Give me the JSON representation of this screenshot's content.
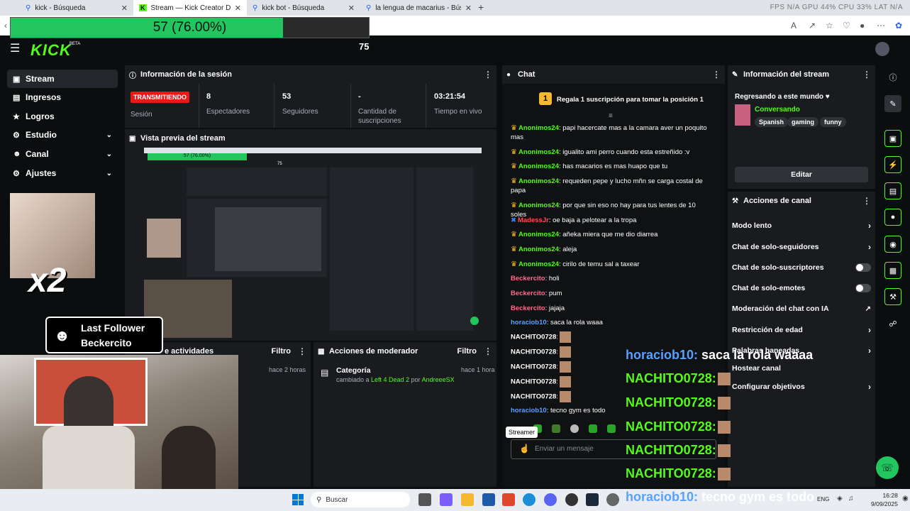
{
  "browser": {
    "tabs": [
      {
        "title": "kick - Búsqueda"
      },
      {
        "title": "Stream — Kick Creator Dashboard"
      },
      {
        "title": "kick bot - Búsqueda"
      },
      {
        "title": "la lengua de macarius - Búsqueda"
      }
    ],
    "hw_stats": "FPS N/A   GPU 44%   CPU 33%   LAT N/A"
  },
  "goal_overlay": {
    "text": "57 (76.00%)",
    "progress": 0.76
  },
  "header": {
    "logo": "KICK",
    "beta": "BETA",
    "center_number": "75"
  },
  "sidebar": {
    "items": [
      {
        "label": "Stream",
        "icon": "video-icon"
      },
      {
        "label": "Ingresos",
        "icon": "money-icon"
      },
      {
        "label": "Logros",
        "icon": "trophy-icon"
      },
      {
        "label": "Estudio",
        "icon": "gear-icon"
      },
      {
        "label": "Canal",
        "icon": "user-icon"
      },
      {
        "label": "Ajustes",
        "icon": "gear-icon"
      }
    ]
  },
  "session": {
    "title": "Información de la sesión",
    "badge": "TRANSMITIENDO",
    "badge_label": "Sesión",
    "stats": [
      {
        "value": "8",
        "label": "Espectadores"
      },
      {
        "value": "53",
        "label": "Seguidores"
      },
      {
        "value": "-",
        "label": "Cantidad de suscripciones"
      },
      {
        "value": "03:21:54",
        "label": "Tiempo en vivo"
      }
    ]
  },
  "preview": {
    "title": "Vista previa del stream",
    "mini_bar": "57 (76.00%)",
    "mini_num": "75"
  },
  "activity": {
    "title": "e actividades",
    "filter": "Filtro",
    "time": "hace 2 horas"
  },
  "moderator": {
    "title": "Acciones de moderador",
    "filter": "Filtro",
    "entry_title": "Categoría",
    "entry_pre": "cambiado a ",
    "entry_game": "Left 4 Dead 2",
    "entry_mid": " por ",
    "entry_user": "AndreeeSX",
    "entry_time": "hace 1 hora"
  },
  "chat": {
    "title": "Chat",
    "pinned_rank": "1",
    "pinned": "Regala 1 suscripción para tomar la posición 1",
    "messages": [
      {
        "user": "Anonimos24",
        "text": ": papi hacercate mas a la camara aver un poquito mas",
        "style": "green",
        "crown": true
      },
      {
        "user": "Anonimos24",
        "text": ": igualito ami perro cuando esta estreñido :v",
        "style": "green",
        "crown": true
      },
      {
        "user": "Anonimos24",
        "text": ": has macarios es mas huapo que tu",
        "style": "green",
        "crown": true
      },
      {
        "user": "Anonimos24",
        "text": ": requeden pepe y lucho mñn se carga costal de papa",
        "style": "green",
        "crown": true
      },
      {
        "user": "Anonimos24",
        "text": ": por que sin eso no hay para tus lentes de 10 soles",
        "style": "green",
        "crown": true
      },
      {
        "user": "MadessJr",
        "text": ": oe baja a pelotear a la tropa",
        "style": "red",
        "crown": false
      },
      {
        "user": "Anonimos24",
        "text": ": añeka miera que me dio diarrea",
        "style": "green",
        "crown": true
      },
      {
        "user": "Anonimos24",
        "text": ": aleja",
        "style": "green",
        "crown": true
      },
      {
        "user": "Anonimos24",
        "text": ": cirilo de temu sal a taxear",
        "style": "green",
        "crown": true
      },
      {
        "user": "Beckercito",
        "text": ": holi",
        "style": "pink",
        "crown": false
      },
      {
        "user": "Beckercito",
        "text": ": pum",
        "style": "pink",
        "crown": false
      },
      {
        "user": "Beckercito",
        "text": ": jajaja",
        "style": "pink",
        "crown": false
      },
      {
        "user": "horaciob10",
        "text": ": saca la rola waaa",
        "style": "blue",
        "crown": false
      },
      {
        "user": "NACHITO0728",
        "text": ":",
        "style": "white",
        "crown": false
      },
      {
        "user": "NACHITO0728",
        "text": ":",
        "style": "white",
        "crown": false
      },
      {
        "user": "NACHITO0728",
        "text": ":",
        "style": "white",
        "crown": false
      },
      {
        "user": "NACHITO0728",
        "text": ":",
        "style": "white",
        "crown": false
      },
      {
        "user": "NACHITO0728",
        "text": ":",
        "style": "white",
        "crown": false
      },
      {
        "user": "horaciob10",
        "text": ": tecno gym es todo",
        "style": "blue",
        "crown": false
      }
    ],
    "tooltip": "Streamer",
    "input_placeholder": "Enviar un mensaje"
  },
  "stream_info": {
    "title": "Información del stream",
    "stream_title": "Regresando a este mundo ♥",
    "category": "Conversando",
    "tags": [
      "Spanish",
      "gaming",
      "funny"
    ],
    "edit": "Editar"
  },
  "channel_actions": {
    "title": "Acciones de canal",
    "items": [
      {
        "label": "Modo lento",
        "control": "chevron"
      },
      {
        "label": "Chat de solo-seguidores",
        "control": "chevron"
      },
      {
        "label": "Chat de solo-suscriptores",
        "control": "toggle"
      },
      {
        "label": "Chat de solo-emotes",
        "control": "toggle"
      },
      {
        "label": "Moderación del chat con IA",
        "control": "external"
      },
      {
        "label": "Restricción de edad",
        "control": "chevron"
      },
      {
        "label": "Palabras baneadas",
        "control": "chevron"
      },
      {
        "label": "Hostear canal",
        "control": "none"
      },
      {
        "label": "Configurar objetivos",
        "control": "chevron"
      }
    ]
  },
  "overlay": {
    "x2": "x2",
    "last_follower_title": "Last Follower",
    "last_follower_name": "Beckercito",
    "big_chat": [
      {
        "user": "horaciob10:",
        "text": " saca la rola waaaa",
        "style": "hor"
      },
      {
        "user": "NACHITO0728:",
        "text": "",
        "style": "nachito"
      },
      {
        "user": "NACHITO0728:",
        "text": "",
        "style": "nachito"
      },
      {
        "user": "NACHITO0728:",
        "text": "",
        "style": "nachito"
      },
      {
        "user": "NACHITO0728:",
        "text": "",
        "style": "nachito"
      },
      {
        "user": "NACHITO0728:",
        "text": "",
        "style": "nachito"
      },
      {
        "user": "horaciob10:",
        "text": " tecno gym es todo",
        "style": "hor"
      }
    ]
  },
  "taskbar": {
    "search": "Buscar",
    "lang": "ENG",
    "time": "16:28",
    "date": "9/09/2025"
  }
}
